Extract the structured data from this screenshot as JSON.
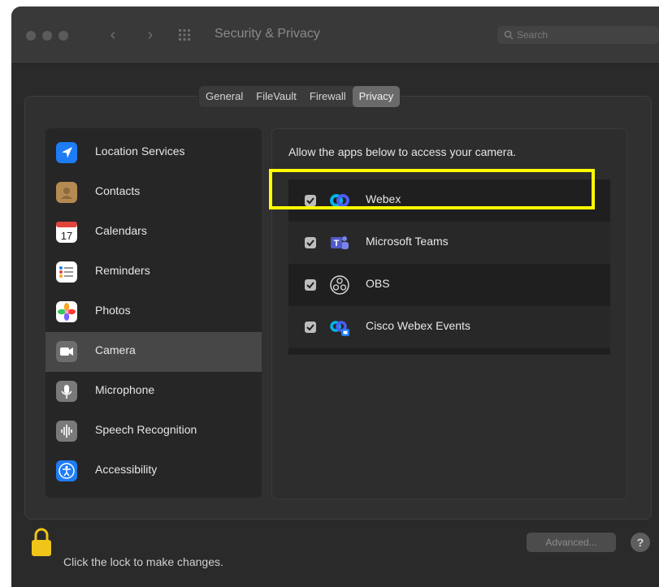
{
  "window": {
    "title": "Security & Privacy",
    "search_placeholder": "Search",
    "nav_back": "‹",
    "nav_forward": "›"
  },
  "tabs": [
    {
      "label": "General",
      "active": false
    },
    {
      "label": "FileVault",
      "active": false
    },
    {
      "label": "Firewall",
      "active": false
    },
    {
      "label": "Privacy",
      "active": true
    }
  ],
  "sidebar": {
    "selected": "Camera",
    "items": [
      {
        "label": "Location Services",
        "icon": "location-arrow-icon",
        "color": "#1e7cf6"
      },
      {
        "label": "Contacts",
        "icon": "contacts-book-icon",
        "color": "#b48a52"
      },
      {
        "label": "Calendars",
        "icon": "calendar-icon",
        "color": "#ffffff",
        "day": "17"
      },
      {
        "label": "Reminders",
        "icon": "reminders-list-icon",
        "color": "#ffffff"
      },
      {
        "label": "Photos",
        "icon": "photos-flower-icon",
        "color": "#ffffff"
      },
      {
        "label": "Camera",
        "icon": "video-camera-icon",
        "color": "#6e6e6e"
      },
      {
        "label": "Microphone",
        "icon": "microphone-icon",
        "color": "#7a7a7a"
      },
      {
        "label": "Speech Recognition",
        "icon": "waveform-icon",
        "color": "#7a7a7a"
      },
      {
        "label": "Accessibility",
        "icon": "accessibility-icon",
        "color": "#1e7cf6"
      }
    ]
  },
  "content": {
    "description": "Allow the apps below to access your camera.",
    "apps": [
      {
        "name": "Webex",
        "checked": true,
        "icon": "webex-icon"
      },
      {
        "name": "Microsoft Teams",
        "checked": true,
        "icon": "microsoft-teams-icon"
      },
      {
        "name": "OBS",
        "checked": true,
        "icon": "obs-icon"
      },
      {
        "name": "Cisco Webex Events",
        "checked": true,
        "icon": "webex-events-icon"
      }
    ]
  },
  "footer": {
    "lock_text": "Click the lock to make changes.",
    "advanced_label": "Advanced...",
    "help_label": "?"
  },
  "colors": {
    "highlight": "#ffff00",
    "window_bg": "#2a2a2a"
  }
}
